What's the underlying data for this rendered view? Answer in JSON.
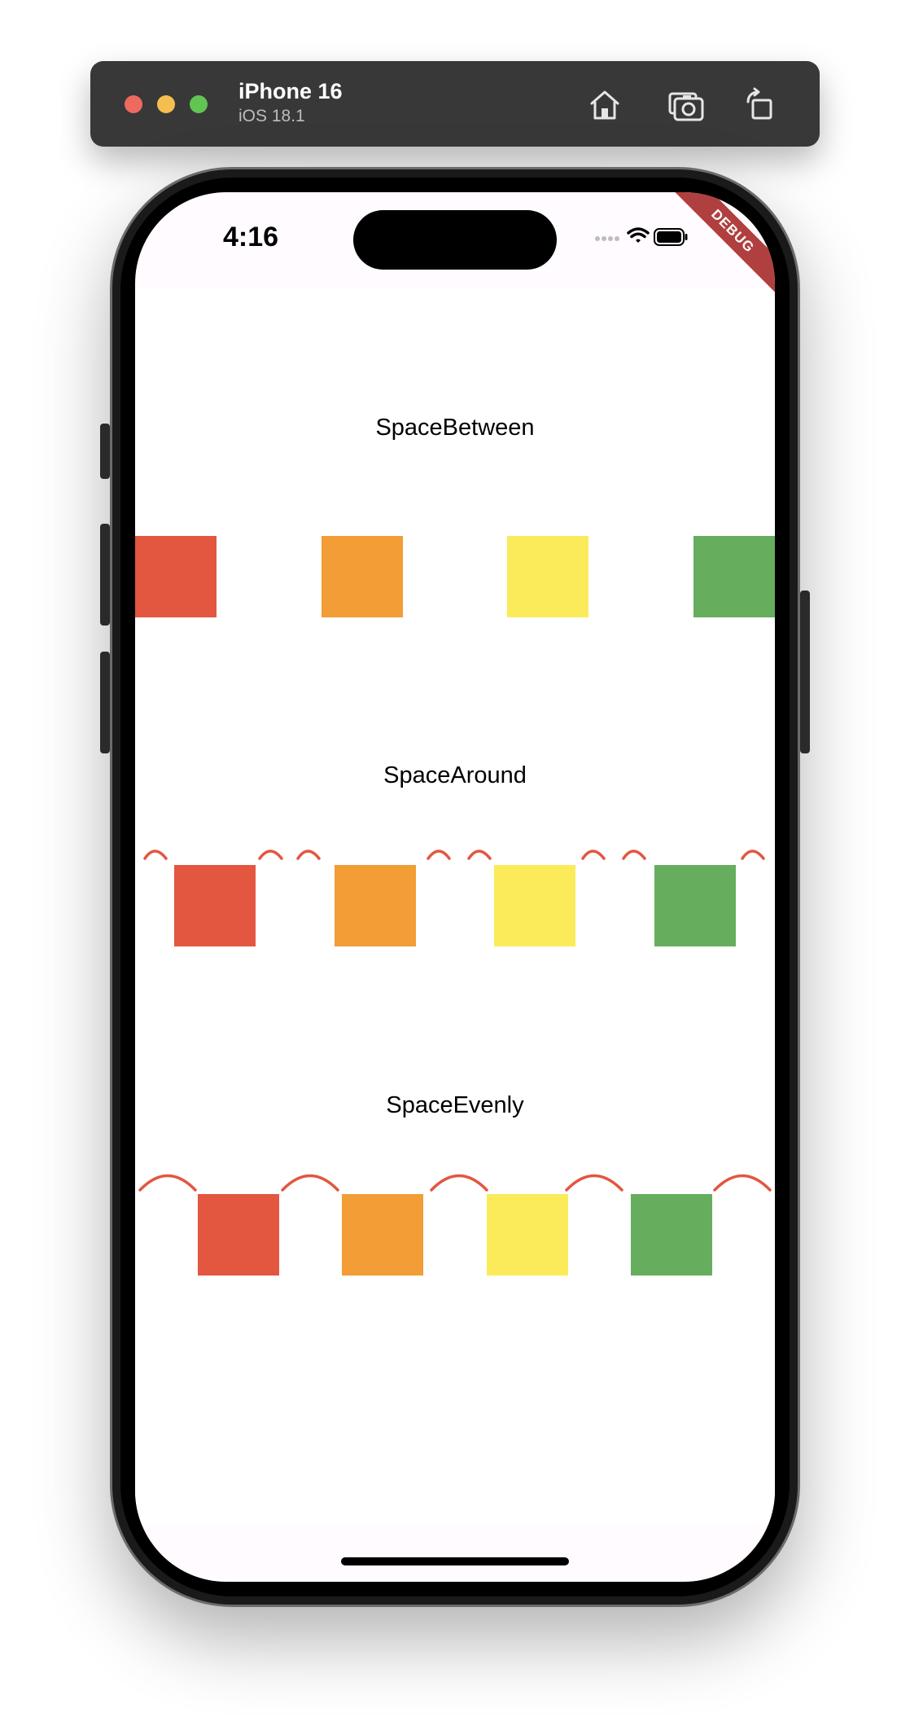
{
  "simulator": {
    "device_name": "iPhone 16",
    "os_version": "iOS 18.1",
    "icons": [
      "home-icon",
      "screenshot-icon",
      "rotate-icon"
    ]
  },
  "status_bar": {
    "time": "4:16",
    "icons": [
      "signal-icon",
      "wifi-icon",
      "battery-icon"
    ]
  },
  "debug_banner": "DEBUG",
  "colors": {
    "red": "#e35640",
    "orange": "#f29d35",
    "yellow": "#fbeb5a",
    "green": "#66ae5d",
    "arc": "#e35640"
  },
  "sections": [
    {
      "label": "SpaceBetween",
      "boxes": [
        "red",
        "orange",
        "yellow",
        "green"
      ]
    },
    {
      "label": "SpaceAround",
      "boxes": [
        "red",
        "orange",
        "yellow",
        "green"
      ]
    },
    {
      "label": "SpaceEvenly",
      "boxes": [
        "red",
        "orange",
        "yellow",
        "green"
      ]
    }
  ]
}
